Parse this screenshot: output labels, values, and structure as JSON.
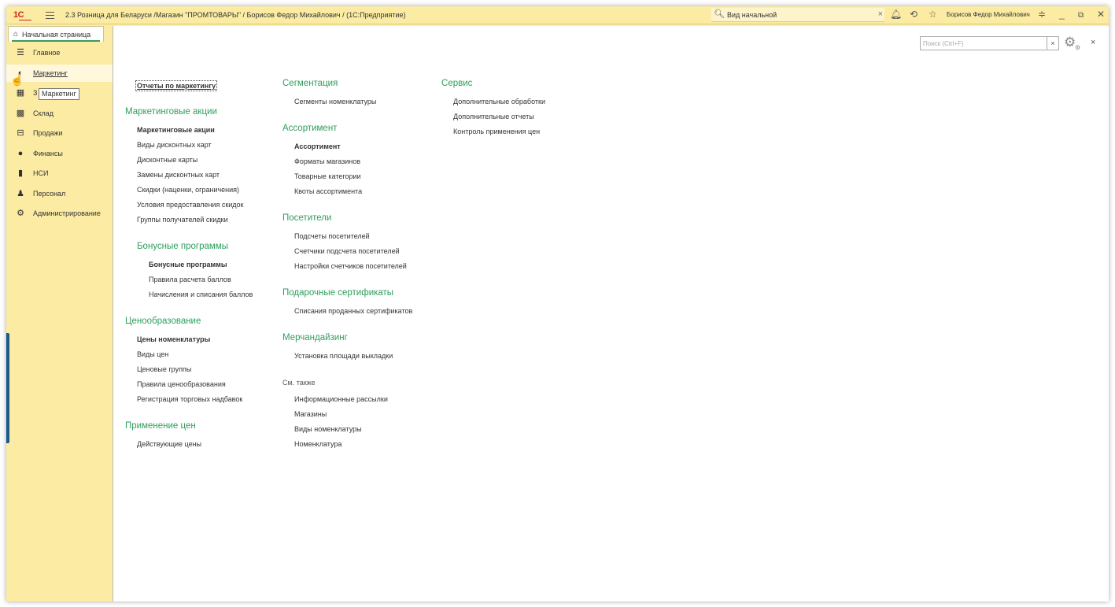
{
  "titlebar": {
    "logo": "1С",
    "title": "2.3 Розница для Беларуси /Магазин \"ПРОМТОВАРЫ\" / Борисов Федор Михайлович  /  (1С:Предприятие)",
    "search_value": "Вид начальной",
    "user": "Борисов Федор Михайлович"
  },
  "tabs": {
    "home": "Начальная страница"
  },
  "sidebar": {
    "items": [
      {
        "label": "Главное",
        "icon": "menu-lines-icon"
      },
      {
        "label": "Маркетинг",
        "icon": "marketing-icon"
      },
      {
        "label": "З",
        "icon": "purchases-icon"
      },
      {
        "label": "Склад",
        "icon": "warehouse-icon"
      },
      {
        "label": "Продажи",
        "icon": "basket-icon"
      },
      {
        "label": "Финансы",
        "icon": "finance-icon"
      },
      {
        "label": "НСИ",
        "icon": "reference-icon"
      },
      {
        "label": "Персонал",
        "icon": "person-icon"
      },
      {
        "label": "Администрирование",
        "icon": "gear-icon"
      }
    ],
    "tooltip": "Маркетинг"
  },
  "main": {
    "search_placeholder": "Поиск (Ctrl+F)",
    "col1": {
      "reports": "Отчеты по маркетингу",
      "promo_header": "Маркетинговые акции",
      "promo_items": [
        "Маркетинговые акции",
        "Виды дисконтных карт",
        "Дисконтные карты",
        "Замены дисконтных карт",
        "Скидки (наценки, ограничения)",
        "Условия предоставления скидок",
        "Группы получателей скидки"
      ],
      "bonus_header": "Бонусные программы",
      "bonus_items": [
        "Бонусные программы",
        "Правила расчета баллов",
        "Начисления и списания баллов"
      ],
      "pricing_header": "Ценообразование",
      "pricing_items": [
        "Цены номенклатуры",
        "Виды цен",
        "Ценовые группы",
        "Правила ценообразования",
        "Регистрация торговых надбавок"
      ],
      "apply_header": "Применение цен",
      "apply_items": [
        "Действующие цены"
      ]
    },
    "col2": {
      "seg_header": "Сегментация",
      "seg_items": [
        "Сегменты номенклатуры"
      ],
      "assort_header": "Ассортимент",
      "assort_items": [
        "Ассортимент",
        "Форматы магазинов",
        "Товарные категории",
        "Квоты ассортимента"
      ],
      "visitors_header": "Посетители",
      "visitors_items": [
        "Подсчеты посетителей",
        "Счетчики подсчета посетителей",
        "Настройки счетчиков посетителей"
      ],
      "gift_header": "Подарочные сертификаты",
      "gift_items": [
        "Списания проданных сертификатов"
      ],
      "merch_header": "Мерчандайзинг",
      "merch_items": [
        "Установка площади выкладки"
      ],
      "see_also": "См. также",
      "see_items": [
        "Информационные рассылки",
        "Магазины",
        "Виды номенклатуры",
        "Номенклатура"
      ]
    },
    "col3": {
      "service_header": "Сервис",
      "service_items": [
        "Дополнительные обработки",
        "Дополнительные отчеты",
        "Контроль применения цен"
      ]
    }
  }
}
